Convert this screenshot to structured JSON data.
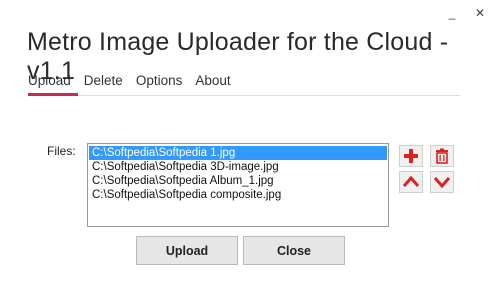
{
  "window": {
    "title": "Metro Image Uploader for the Cloud - v1.1",
    "minimize_label": "_",
    "close_label": "✕"
  },
  "tabs": [
    {
      "label": "Upload",
      "active": true
    },
    {
      "label": "Delete",
      "active": false
    },
    {
      "label": "Options",
      "active": false
    },
    {
      "label": "About",
      "active": false
    }
  ],
  "files": {
    "label": "Files:",
    "items": [
      "C:\\Softpedia\\Softpedia 1.jpg",
      "C:\\Softpedia\\Softpedia 3D-image.jpg",
      "C:\\Softpedia\\Softpedia Album_1.jpg",
      "C:\\Softpedia\\Softpedia composite.jpg"
    ],
    "selected_index": 0
  },
  "side_buttons": {
    "add_icon": "plus-icon",
    "delete_icon": "trash-icon",
    "up_icon": "chevron-up-icon",
    "down_icon": "chevron-down-icon",
    "icon_color": "#e02020"
  },
  "actions": {
    "upload_label": "Upload",
    "close_label": "Close"
  },
  "colors": {
    "accent": "#c62a52",
    "selection": "#3399ff"
  }
}
